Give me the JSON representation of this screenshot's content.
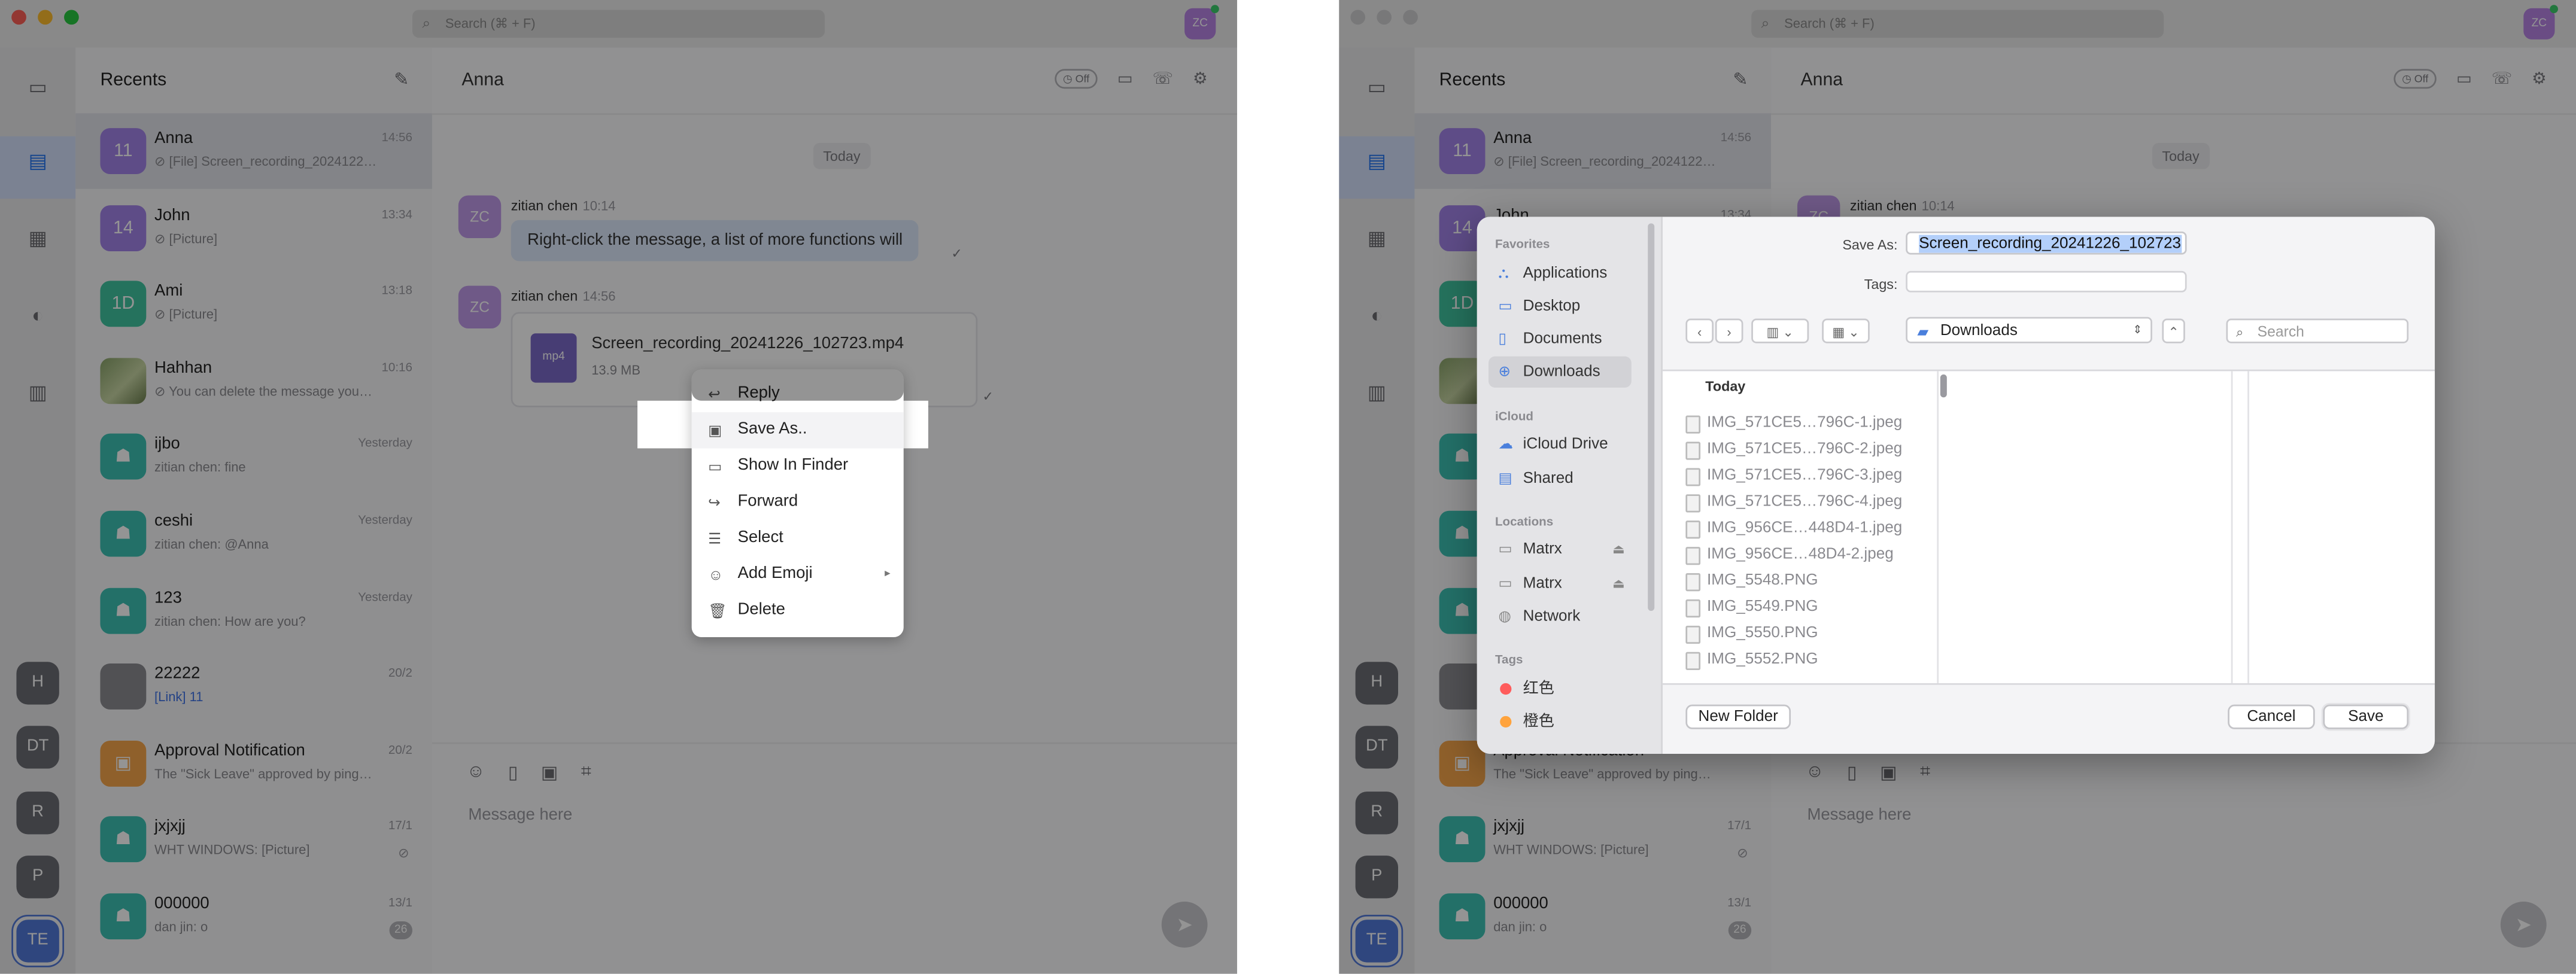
{
  "search_placeholder": "Search (⌘ + F)",
  "my_avatar": "ZC",
  "workspaces": [
    "H",
    "DT",
    "R",
    "P",
    "TE"
  ],
  "list": {
    "title": "Recents",
    "conversations": [
      {
        "avatar": "11",
        "name": "Anna",
        "preview": "⊘ [File] Screen_recording_2024122…",
        "time": "14:56",
        "color": "purple"
      },
      {
        "avatar": "14",
        "name": "John",
        "preview": "⊘ [Picture]",
        "time": "13:34",
        "color": "purple"
      },
      {
        "avatar": "1D",
        "name": "Ami",
        "preview": "⊘ [Picture]",
        "time": "13:18",
        "color": "green"
      },
      {
        "avatar": "",
        "name": "Hahhan",
        "preview": "⊘ You can delete the message you…",
        "time": "10:16",
        "color": "photo"
      },
      {
        "avatar": "",
        "name": "ijbo",
        "preview": "zitian chen: fine",
        "time": "Yesterday",
        "color": "teal"
      },
      {
        "avatar": "",
        "name": "ceshi",
        "preview": "zitian chen: @Anna",
        "time": "Yesterday",
        "color": "teal"
      },
      {
        "avatar": "",
        "name": "123",
        "preview": "zitian chen: How are you?",
        "time": "Yesterday",
        "color": "teal"
      },
      {
        "avatar": "",
        "name": "22222",
        "preview": "[Link] 11",
        "time": "20/2",
        "color": "gray"
      },
      {
        "avatar": "",
        "name": "Approval Notification",
        "preview": "The \"Sick Leave\" approved by ping…",
        "time": "20/2",
        "color": "orange"
      },
      {
        "avatar": "",
        "name": "jxjxjj",
        "preview": "WHT WINDOWS: [Picture]",
        "time": "17/1",
        "color": "teal"
      },
      {
        "avatar": "",
        "name": "000000",
        "preview": "dan jin: o",
        "time": "13/1",
        "color": "teal",
        "badge": "26"
      }
    ]
  },
  "chat": {
    "title": "Anna",
    "off_label": "Off",
    "date_divider": "Today",
    "messages": [
      {
        "avatar": "ZC",
        "sender": "zitian chen",
        "time": "10:14",
        "text": "Right-click the message, a list of more functions will"
      },
      {
        "avatar": "ZC",
        "sender": "zitian chen",
        "time": "14:56",
        "file_badge": "mp4",
        "file_name": "Screen_recording_20241226_102723.mp4",
        "file_size": "13.9 MB"
      }
    ],
    "input_placeholder": "Message here"
  },
  "context_menu": {
    "items": [
      "Reply",
      "Save As..",
      "Show In Finder",
      "Forward",
      "Select",
      "Add Emoji",
      "Delete"
    ]
  },
  "save_dialog": {
    "save_as_label": "Save As:",
    "save_as_value": "Screen_recording_20241226_102723",
    "tags_label": "Tags:",
    "sidebar": {
      "favorites_label": "Favorites",
      "favorites": [
        "Applications",
        "Desktop",
        "Documents",
        "Downloads"
      ],
      "icloud_label": "iCloud",
      "icloud": [
        "iCloud Drive",
        "Shared"
      ],
      "locations_label": "Locations",
      "locations": [
        "Matrx",
        "Matrx",
        "Network"
      ],
      "tags_label": "Tags",
      "tags": [
        {
          "name": "红色",
          "color": "#ff5c5c"
        },
        {
          "name": "橙色",
          "color": "#ffa33d"
        }
      ]
    },
    "current_folder": "Downloads",
    "search_placeholder": "Search",
    "column_header": "Today",
    "files": [
      "IMG_571CE5…796C-1.jpeg",
      "IMG_571CE5…796C-2.jpeg",
      "IMG_571CE5…796C-3.jpeg",
      "IMG_571CE5…796C-4.jpeg",
      "IMG_956CE…448D4-1.jpeg",
      "IMG_956CE…48D4-2.jpeg",
      "IMG_5548.PNG",
      "IMG_5549.PNG",
      "IMG_5550.PNG",
      "IMG_5552.PNG"
    ],
    "new_folder_label": "New Folder",
    "cancel_label": "Cancel",
    "save_label": "Save"
  }
}
